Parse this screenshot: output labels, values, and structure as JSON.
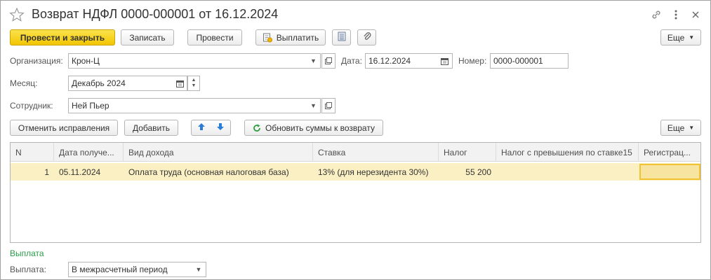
{
  "window": {
    "title": "Возврат НДФЛ 0000-000001 от 16.12.2024",
    "icons": [
      "star-icon",
      "link-icon",
      "more-vert-icon",
      "close-icon"
    ]
  },
  "toolbar": {
    "post_close": "Провести и закрыть",
    "save": "Записать",
    "post": "Провести",
    "pay": "Выплатить",
    "more": "Еще"
  },
  "form": {
    "org_label": "Организация:",
    "org_value": "Крон-Ц",
    "date_label": "Дата:",
    "date_value": "16.12.2024",
    "number_label": "Номер:",
    "number_value": "0000-000001",
    "month_label": "Месяц:",
    "month_value": "Декабрь 2024",
    "employee_label": "Сотрудник:",
    "employee_value": "Ней Пьер"
  },
  "table_toolbar": {
    "cancel_corrections": "Отменить исправления",
    "add": "Добавить",
    "refresh": "Обновить суммы к возврату",
    "more": "Еще"
  },
  "table": {
    "headers": [
      "N",
      "Дата получе...",
      "Вид дохода",
      "Ставка",
      "Налог",
      "Налог с превышения по ставке15",
      "Регистрац..."
    ],
    "rows": [
      [
        "1",
        "05.11.2024",
        "Оплата труда (основная налоговая база)",
        "13% (для нерезидента 30%)",
        "55 200",
        "",
        ""
      ]
    ]
  },
  "payment": {
    "section_title": "Выплата",
    "label": "Выплата:",
    "value": "В межрасчетный период"
  },
  "colors": {
    "primary_button": "#f2c500",
    "selected_row": "#fbf0c3",
    "section_title": "#2a9a48",
    "arrow_blue": "#2b7bd8",
    "refresh_green": "#2e9e3e"
  }
}
